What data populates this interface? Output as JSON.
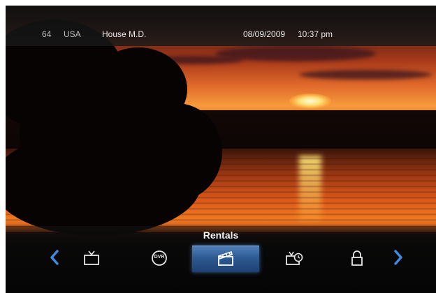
{
  "status_bar": {
    "channel_number": "64",
    "channel_name": "USA",
    "program_title": "House M.D.",
    "date": "08/09/2009",
    "time": "10:37 pm"
  },
  "menu": {
    "title": "Rentals",
    "selected_index": 2,
    "items": [
      {
        "icon": "tv-icon"
      },
      {
        "icon": "dvr-icon",
        "label": "DVR"
      },
      {
        "icon": "clapperboard-icon"
      },
      {
        "icon": "tv-clock-icon"
      },
      {
        "icon": "lock-icon"
      }
    ]
  },
  "colors": {
    "highlight": "#2d5a92",
    "arrow": "#3f8be0"
  }
}
